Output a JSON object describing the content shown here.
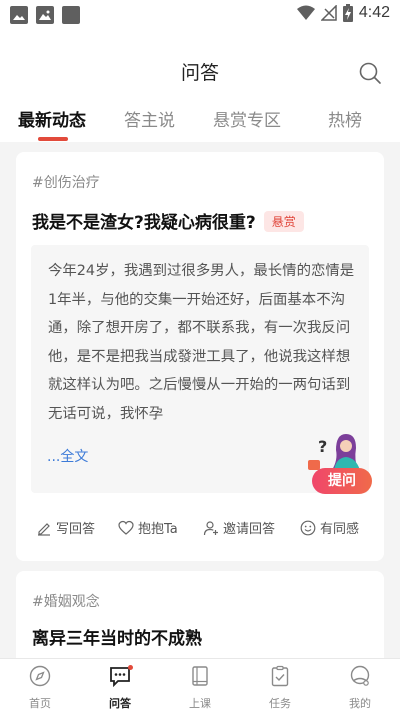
{
  "status_bar": {
    "time": "4:42",
    "colors": {
      "icon": "#5f5f5f"
    }
  },
  "header": {
    "title": "问答",
    "search_icon": "search-icon"
  },
  "tabs": [
    {
      "label": "最新动态",
      "active": true
    },
    {
      "label": "答主说",
      "active": false
    },
    {
      "label": "悬赏专区",
      "active": false
    },
    {
      "label": "热榜",
      "active": false
    }
  ],
  "feed": [
    {
      "topic": "#创伤治疗",
      "title": "我是不是渣女?我疑心病很重?",
      "badge": "悬赏",
      "excerpt": "今年24岁，我遇到过很多男人，最长情的恋情是1年半，与他的交集一开始还好，后面基本不沟通，除了想开房了，都不联系我，有一次我反问他，是不是把我当成發泄工具了，他说我这样想就这样认为吧。之后慢慢从一开始的一两句话到无话可说，我怀孕",
      "read_more": "...全文",
      "actions": {
        "answer": "写回答",
        "hug": "抱抱Ta",
        "invite": "邀请回答",
        "agree": "有同感"
      }
    },
    {
      "topic": "#婚姻观念",
      "title": "离异三年当时的不成熟"
    }
  ],
  "ask_button": {
    "label": "提问",
    "question_mark": "?"
  },
  "bottom_nav": [
    {
      "label": "首页",
      "icon": "compass-icon",
      "active": false
    },
    {
      "label": "问答",
      "icon": "chat-bubble-icon",
      "active": true
    },
    {
      "label": "上课",
      "icon": "book-icon",
      "active": false
    },
    {
      "label": "任务",
      "icon": "clipboard-check-icon",
      "active": false
    },
    {
      "label": "我的",
      "icon": "profile-icon",
      "active": false
    }
  ],
  "colors": {
    "accent": "#e24a3b",
    "link": "#3d7bd8",
    "badge_bg": "#fde6e5",
    "ask_gradient_start": "#f0466b",
    "ask_gradient_end": "#f06a4a"
  }
}
